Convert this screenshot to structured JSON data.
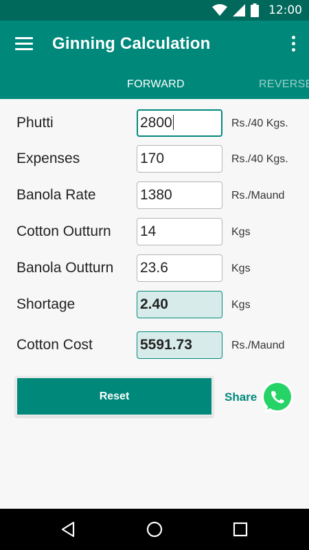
{
  "status_bar": {
    "time": "12:00",
    "icons": [
      "wifi-icon",
      "signal-icon",
      "battery-icon"
    ]
  },
  "app_bar": {
    "title": "Ginning Calculation",
    "menu_icon": "hamburger-menu-icon",
    "overflow_icon": "more-vert-icon"
  },
  "tabs": [
    {
      "label": "FORWARD",
      "active": true
    },
    {
      "label": "REVERSE",
      "active": false
    }
  ],
  "form": {
    "phutti": {
      "label": "Phutti",
      "value": "2800",
      "unit": "Rs./40 Kgs."
    },
    "expenses": {
      "label": "Expenses",
      "value": "170",
      "unit": "Rs./40 Kgs."
    },
    "banola_rate": {
      "label": "Banola Rate",
      "value": "1380",
      "unit": "Rs./Maund"
    },
    "cotton_outturn": {
      "label": "Cotton Outturn",
      "value": "14",
      "unit": "Kgs"
    },
    "banola_outturn": {
      "label": "Banola Outturn",
      "value": "23.6",
      "unit": "Kgs"
    },
    "shortage": {
      "label": "Shortage",
      "value": "2.40",
      "unit": "Kgs"
    },
    "cotton_cost": {
      "label": "Cotton Cost",
      "value": "5591.73",
      "unit": "Rs./Maund"
    }
  },
  "actions": {
    "reset_label": "Reset",
    "share_label": "Share",
    "share_icon": "whatsapp-icon"
  },
  "nav": {
    "icons": [
      "back-icon",
      "home-icon",
      "recents-icon"
    ]
  },
  "colors": {
    "primary": "#00897b",
    "primary_dark": "#00695c",
    "result_bg": "#d7ecea",
    "whatsapp": "#25d366"
  }
}
